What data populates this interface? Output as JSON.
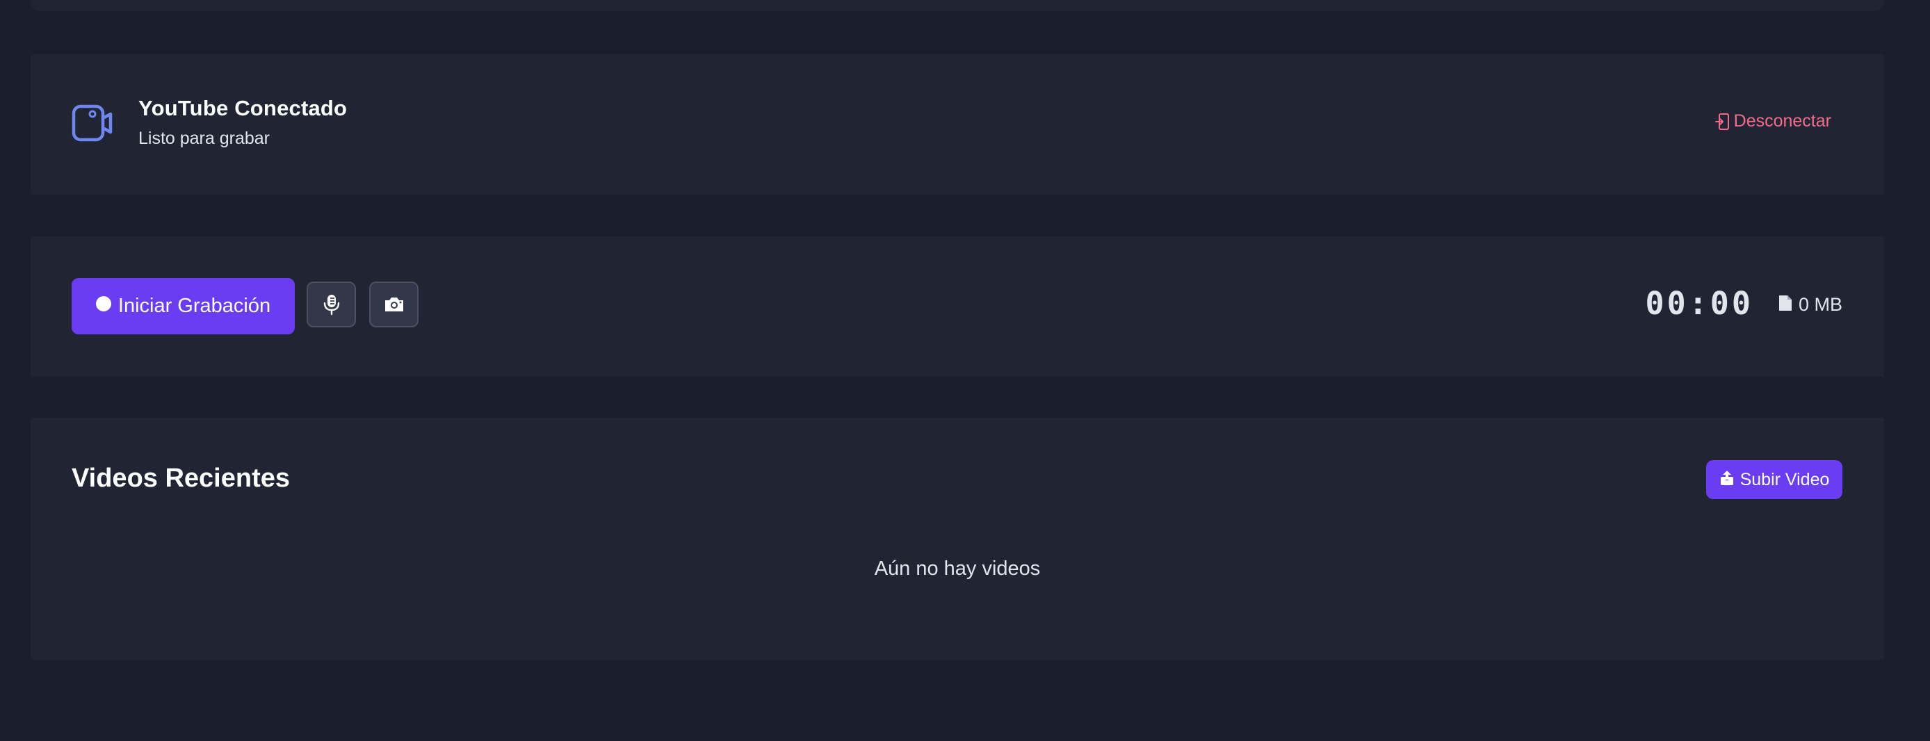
{
  "connection": {
    "title": "YouTube Conectado",
    "subtitle": "Listo para grabar",
    "disconnect_label": "Desconectar",
    "icon": "video-camera-icon"
  },
  "recorder": {
    "start_label": "Iniciar Grabación",
    "timer": "00:00",
    "file_size": "0 MB",
    "mic_icon": "microphone-icon",
    "camera_icon": "camera-icon"
  },
  "videos": {
    "title": "Videos Recientes",
    "upload_label": "Subir Video",
    "empty_message": "Aún no hay videos"
  },
  "colors": {
    "background": "#1b1e2c",
    "panel": "#212533",
    "accent": "#6a3df2",
    "danger": "#f46b8a",
    "icon_blue": "#6f86f0"
  }
}
